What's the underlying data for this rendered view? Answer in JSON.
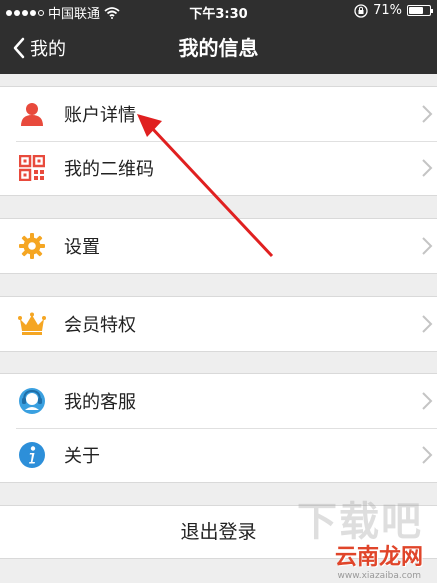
{
  "status_bar": {
    "carrier": "中国联通",
    "time": "下午3:30",
    "battery": "71%",
    "battery_level": 0.71,
    "signal_icon": "signal-dots-icon",
    "wifi_icon": "wifi-icon",
    "lock_icon": "orientation-lock-icon"
  },
  "nav": {
    "back_label": "我的",
    "title": "我的信息"
  },
  "menu": {
    "account": {
      "label": "账户详情",
      "icon": "person-icon",
      "color": "#e84a3c"
    },
    "qrcode": {
      "label": "我的二维码",
      "icon": "qrcode-icon",
      "color": "#e84a3c"
    },
    "settings": {
      "label": "设置",
      "icon": "gear-icon",
      "color": "#f5a623"
    },
    "vip": {
      "label": "会员特权",
      "icon": "crown-icon",
      "color": "#f5a623"
    },
    "service": {
      "label": "我的客服",
      "icon": "headset-icon",
      "color": "#3aa0e0"
    },
    "about": {
      "label": "关于",
      "icon": "info-icon",
      "color": "#2d8fd9"
    }
  },
  "logout_label": "退出登录",
  "watermark": {
    "big": "下载吧",
    "brand": "云南龙网",
    "url": "www.xiazaiba.com"
  },
  "annotation_color": "#e02020"
}
